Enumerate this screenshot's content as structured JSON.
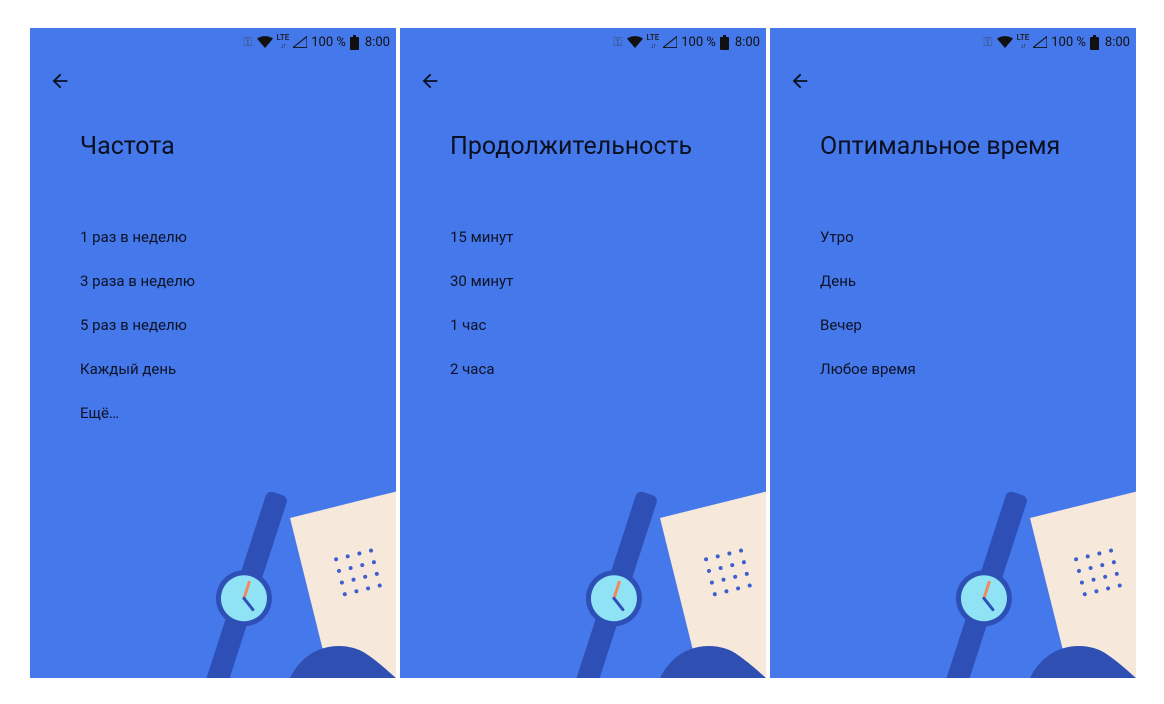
{
  "status": {
    "lte": "LTE",
    "pct": "100 %",
    "time": "8:00"
  },
  "screens": [
    {
      "title": "Частота",
      "options": [
        "1 раз в неделю",
        "3 раза в неделю",
        "5 раз в неделю",
        "Каждый день",
        "Ещё…"
      ]
    },
    {
      "title": "Продолжительность",
      "options": [
        "15 минут",
        "30 минут",
        "1 час",
        "2 часа"
      ]
    },
    {
      "title": "Оптимальное время",
      "options": [
        "Утро",
        "День",
        "Вечер",
        "Любое время"
      ]
    }
  ]
}
